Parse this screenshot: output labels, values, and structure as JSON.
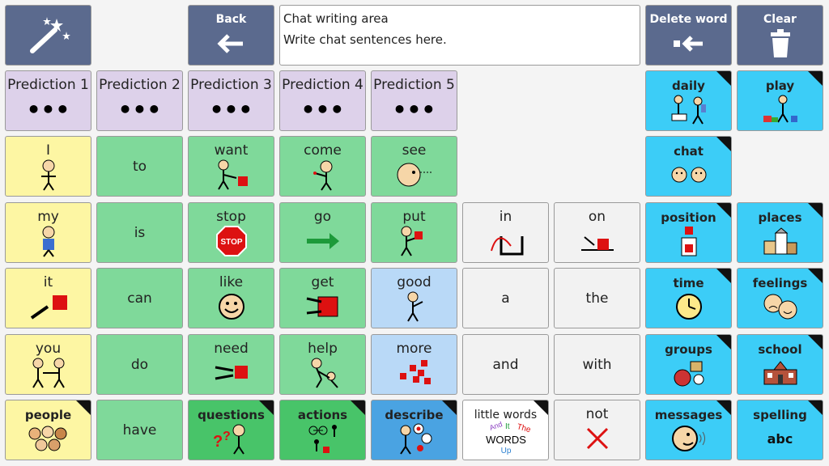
{
  "top": {
    "back": "Back",
    "delete_word": "Delete word",
    "clear": "Clear",
    "chat_title": "Chat writing area",
    "chat_placeholder": "Write chat sentences here."
  },
  "predictions": [
    {
      "label": "Prediction 1",
      "value": "•••"
    },
    {
      "label": "Prediction 2",
      "value": "•••"
    },
    {
      "label": "Prediction 3",
      "value": "•••"
    },
    {
      "label": "Prediction 4",
      "value": "•••"
    },
    {
      "label": "Prediction 5",
      "value": "•••"
    }
  ],
  "words": {
    "i": "I",
    "to": "to",
    "want": "want",
    "come": "come",
    "see": "see",
    "my": "my",
    "is": "is",
    "stop": "stop",
    "go": "go",
    "put": "put",
    "in": "in",
    "on": "on",
    "it": "it",
    "can": "can",
    "like": "like",
    "get": "get",
    "good": "good",
    "a": "a",
    "the": "the",
    "you": "you",
    "do": "do",
    "need": "need",
    "help": "help",
    "more": "more",
    "and": "and",
    "with": "with",
    "have": "have",
    "not": "not"
  },
  "folders": {
    "daily": "daily",
    "play": "play",
    "chat": "chat",
    "position": "position",
    "places": "places",
    "time": "time",
    "feelings": "feelings",
    "groups": "groups",
    "school": "school",
    "messages": "messages",
    "spelling": "spelling",
    "spelling_sub": "abc",
    "people": "people",
    "questions": "questions",
    "actions": "actions",
    "describe": "describe",
    "little_words": "little words"
  },
  "little_words_art": {
    "and": "And",
    "it": "It",
    "the": "The",
    "words": "WORDS",
    "up": "Up"
  },
  "stop_sign": "STOP",
  "colors": {
    "yellow": "#fdf6a3",
    "green": "#7fd99a",
    "dark_green": "#48c469",
    "lilac": "#ddd1ea",
    "white": "#f2f2f2",
    "light_blue": "#b9d9f7",
    "blue": "#4aa3e2",
    "cyan": "#3ccdf7",
    "slate": "#5b6a8e"
  }
}
